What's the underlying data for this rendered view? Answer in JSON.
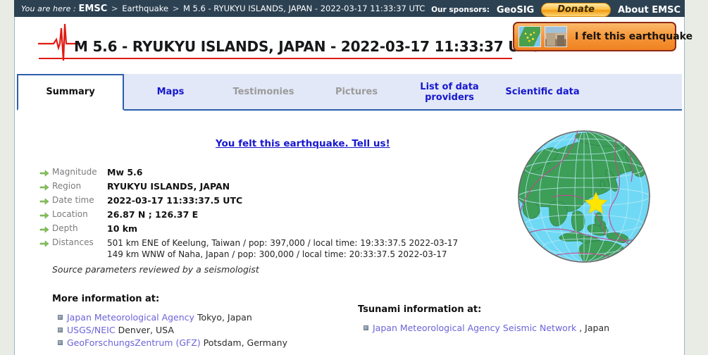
{
  "topbar": {
    "lead": "You are here :",
    "crumbs": [
      "EMSC",
      "Earthquake",
      "M 5.6 - RYUKYU ISLANDS, JAPAN - 2022-03-17 11:33:37 UTC"
    ],
    "separator": ">",
    "sponsors_label": "Our sponsors:",
    "sponsor_name": "GeoSIG",
    "donate_label": "Donate",
    "about_label": "About EMSC",
    "bar_color": "#2c4152"
  },
  "header": {
    "title": "M 5.6 - RYUKYU ISLANDS, JAPAN - 2022-03-17 11:33:37 UTC",
    "rule_color": "#e01b12",
    "felt_button_label": "I felt this earthquake",
    "felt_button_color": "#f59335"
  },
  "tabs": [
    {
      "label": "Summary",
      "state": "active"
    },
    {
      "label": "Maps",
      "state": "link"
    },
    {
      "label": "Testimonies",
      "state": "disabled"
    },
    {
      "label": "Pictures",
      "state": "disabled"
    },
    {
      "label": "List of data providers",
      "state": "link",
      "line1": "List of data",
      "line2": "providers"
    },
    {
      "label": "Scientific data",
      "state": "link"
    }
  ],
  "main": {
    "tell_us_link": "You felt this earthquake. Tell us!",
    "facts": [
      {
        "label": "Magnitude",
        "value": "Mw 5.6",
        "bold": true
      },
      {
        "label": "Region",
        "value": "RYUKYU ISLANDS, JAPAN",
        "bold": true
      },
      {
        "label": "Date time",
        "value": "2022-03-17 11:33:37.5 UTC",
        "bold": true
      },
      {
        "label": "Location",
        "value": "26.87 N ; 126.37 E",
        "bold": true
      },
      {
        "label": "Depth",
        "value": "10 km",
        "bold": true
      }
    ],
    "distances_label": "Distances",
    "distances": [
      "501 km ENE of Keelung, Taiwan / pop: 397,000 / local time: 19:33:37.5 2022-03-17",
      "149 km WNW of Naha, Japan / pop: 300,000 / local time: 20:33:37.5 2022-03-17"
    ],
    "reviewed_note": "Source parameters reviewed by a seismologist",
    "more_info_heading": "More information at:",
    "more_info_links": [
      {
        "link": "Japan Meteorological Agency",
        "rest": "Tokyo, Japan"
      },
      {
        "link": "USGS/NEIC",
        "rest": "Denver, USA"
      },
      {
        "link": "GeoForschungsZentrum (GFZ)",
        "rest": "Potsdam, Germany"
      }
    ],
    "tsunami_heading": "Tsunami information at:",
    "tsunami_links": [
      {
        "link": "Japan Meteorological Agency Seismic Network",
        "rest": ", Japan"
      }
    ]
  },
  "globe": {
    "epicenter_marker": "yellow-star",
    "ocean_color": "#6fd9f5",
    "land_color": "#3d9e58",
    "star_color": "#ffe500"
  }
}
